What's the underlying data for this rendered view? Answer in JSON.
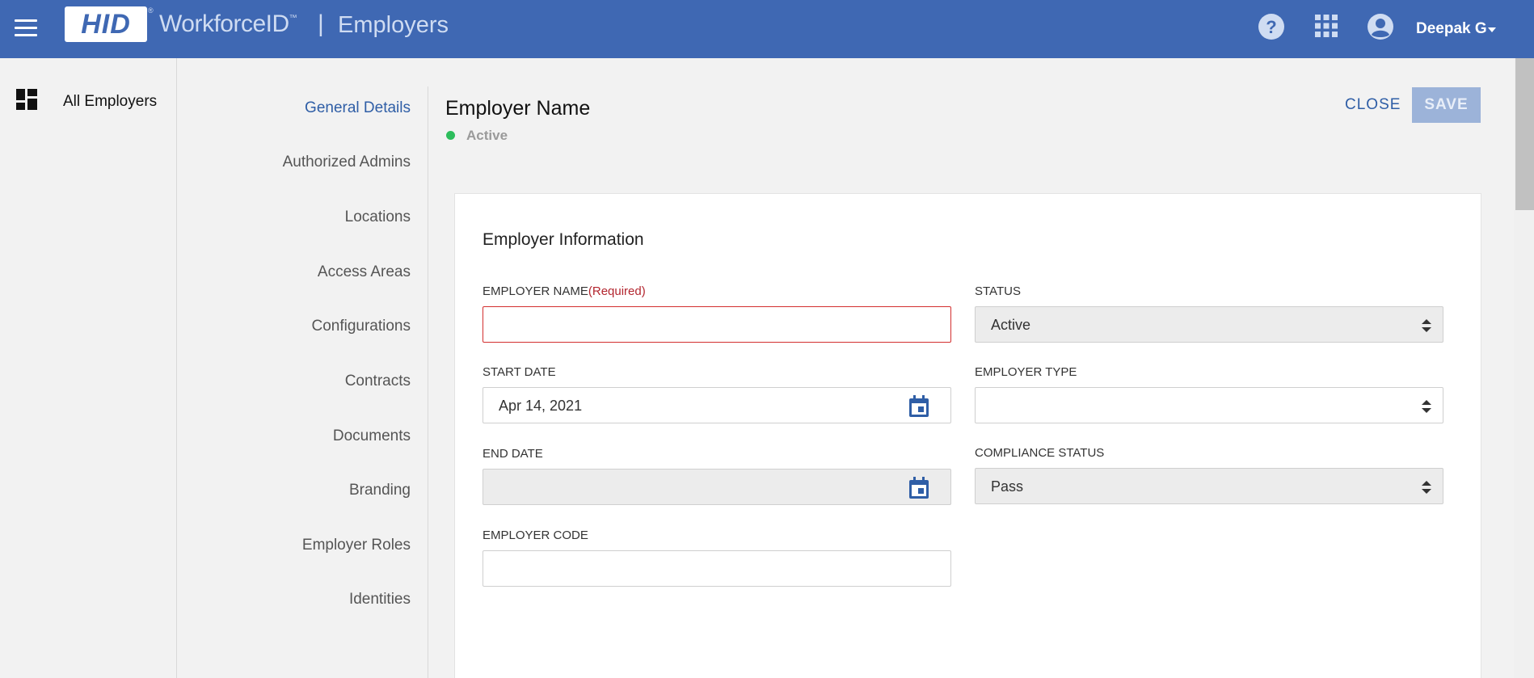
{
  "header": {
    "brand": "HID",
    "brand_mark": "®",
    "product": "WorkforceID",
    "product_mark": "™",
    "separator": "|",
    "page": "Employers",
    "user": "Deepak G",
    "icons": [
      "menu-icon",
      "help-icon",
      "apps-grid-icon",
      "account-icon",
      "caret-down-icon"
    ]
  },
  "leftnav": {
    "items": [
      {
        "label": "All Employers",
        "icon": "dashboard-icon"
      }
    ]
  },
  "sections": [
    {
      "label": "General Details",
      "active": true
    },
    {
      "label": "Authorized Admins",
      "active": false
    },
    {
      "label": "Locations",
      "active": false
    },
    {
      "label": "Access Areas",
      "active": false
    },
    {
      "label": "Configurations",
      "active": false
    },
    {
      "label": "Contracts",
      "active": false
    },
    {
      "label": "Documents",
      "active": false
    },
    {
      "label": "Branding",
      "active": false
    },
    {
      "label": "Employer Roles",
      "active": false
    },
    {
      "label": "Identities",
      "active": false
    }
  ],
  "page": {
    "title": "Employer Name",
    "status": "Active",
    "close_label": "CLOSE",
    "save_label": "SAVE"
  },
  "card": {
    "title": "Employer Information",
    "fields": {
      "employer_name": {
        "label": "EMPLOYER NAME",
        "required": "(Required)",
        "value": ""
      },
      "status": {
        "label": "STATUS",
        "value": "Active"
      },
      "start_date": {
        "label": "START DATE",
        "value": "Apr 14, 2021"
      },
      "employer_type": {
        "label": "EMPLOYER TYPE",
        "value": ""
      },
      "end_date": {
        "label": "END DATE",
        "value": ""
      },
      "compliance_status": {
        "label": "COMPLIANCE STATUS",
        "value": "Pass"
      },
      "employer_code": {
        "label": "EMPLOYER CODE",
        "value": ""
      }
    }
  },
  "colors": {
    "topbar": "#3f68b3",
    "accent": "#2f5ea6",
    "status_active": "#2dbd5c",
    "required": "#b3262f",
    "save_disabled": "#9cb3d9"
  }
}
